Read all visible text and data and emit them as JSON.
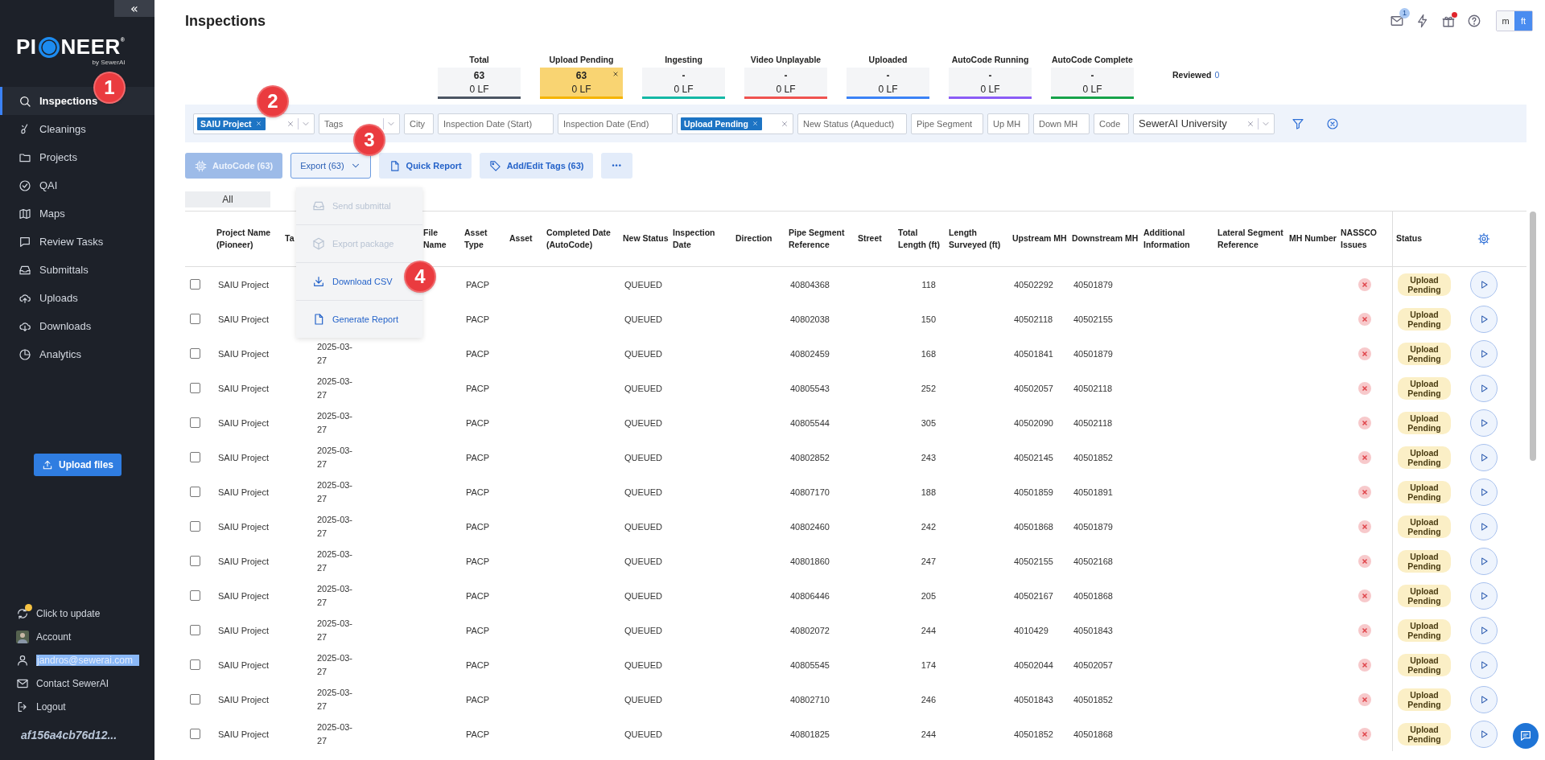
{
  "sidebar": {
    "collapse_button": "«",
    "logo": {
      "left": "PI",
      "right": "NEER",
      "mark": "®",
      "tagline": "by SewerAI"
    },
    "items": [
      {
        "label": "Inspections",
        "selected": true
      },
      {
        "label": "Cleanings",
        "selected": false
      },
      {
        "label": "Projects",
        "selected": false
      },
      {
        "label": "QAI",
        "selected": false
      },
      {
        "label": "Maps",
        "selected": false
      },
      {
        "label": "Review Tasks",
        "selected": false
      },
      {
        "label": "Submittals",
        "selected": false
      },
      {
        "label": "Uploads",
        "selected": false
      },
      {
        "label": "Downloads",
        "selected": false
      },
      {
        "label": "Analytics",
        "selected": false
      }
    ],
    "upload_button": "Upload files",
    "footer": {
      "update": {
        "label": "Click to update",
        "dot": true
      },
      "account": "Account",
      "email": {
        "text": "jandros@sewerai.com",
        "highlighted": true
      },
      "contact": "Contact SewerAI",
      "logout": "Logout",
      "build": "af156a4cb76d12..."
    }
  },
  "page": {
    "title": "Inspections",
    "toolbar": {
      "mail_badge": "1",
      "gift_dot": true,
      "units": [
        {
          "label": "m",
          "selected": false
        },
        {
          "label": "ft",
          "selected": true
        }
      ]
    }
  },
  "status_cards": [
    {
      "label": "Total",
      "count": "63",
      "lf": "0 LF",
      "color": "#4b5563",
      "selected": false
    },
    {
      "label": "Upload Pending",
      "count": "63",
      "lf": "0 LF",
      "color": "#f5b400",
      "selected": true
    },
    {
      "label": "Ingesting",
      "count": "-",
      "lf": "0 LF",
      "color": "#14b8a6",
      "selected": false
    },
    {
      "label": "Video Unplayable",
      "count": "-",
      "lf": "0 LF",
      "color": "#ef5350",
      "selected": false
    },
    {
      "label": "Uploaded",
      "count": "-",
      "lf": "0 LF",
      "color": "#3b82f6",
      "selected": false
    },
    {
      "label": "AutoCode Running",
      "count": "-",
      "lf": "0 LF",
      "color": "#8b5cf6",
      "selected": false
    },
    {
      "label": "AutoCode Complete",
      "count": "-",
      "lf": "0 LF",
      "color": "#16a34a",
      "selected": false
    }
  ],
  "reviewed": {
    "label": "Reviewed",
    "count": "0"
  },
  "filters": [
    {
      "kind": "select",
      "chips": [
        "SAIU Project"
      ],
      "clearable": true,
      "caret": true
    },
    {
      "kind": "select",
      "placeholder": "Tags",
      "clearable": false,
      "caret": true
    },
    {
      "kind": "input",
      "placeholder": "City"
    },
    {
      "kind": "input",
      "placeholder": "Inspection Date (Start)"
    },
    {
      "kind": "input",
      "placeholder": "Inspection Date (End)"
    },
    {
      "kind": "select",
      "chips": [
        "Upload Pending"
      ],
      "clearable": true,
      "caret": false
    },
    {
      "kind": "input",
      "placeholder": "New Status (Aqueduct)"
    },
    {
      "kind": "input",
      "placeholder": "Pipe Segment"
    },
    {
      "kind": "input",
      "placeholder": "Up MH"
    },
    {
      "kind": "input",
      "placeholder": "Down MH"
    },
    {
      "kind": "input",
      "placeholder": "Code"
    },
    {
      "kind": "select",
      "value": "SewerAI University",
      "clearable": true,
      "caret": true
    }
  ],
  "actions": [
    {
      "kind": "autocode",
      "label": "AutoCode (63)",
      "disabled": true
    },
    {
      "kind": "export",
      "label": "Export (63)",
      "disabled": false,
      "expanded": true
    },
    {
      "kind": "report",
      "label": "Quick Report",
      "disabled": false
    },
    {
      "kind": "tags",
      "label": "Add/Edit Tags (63)",
      "disabled": false
    },
    {
      "kind": "more",
      "label": "•••",
      "disabled": false
    }
  ],
  "export_menu": [
    {
      "label": "Send submittal",
      "disabled": true
    },
    {
      "label": "Export package",
      "disabled": true
    },
    {
      "label": "Download CSV",
      "disabled": false
    },
    {
      "label": "Generate Report",
      "disabled": false
    }
  ],
  "tabs": [
    {
      "label": "All",
      "selected": true
    }
  ],
  "table": {
    "columns": [
      "Project Name (Pioneer)",
      "Ta",
      null,
      "File Name",
      "Asset Type",
      "Asset",
      "Completed Date (AutoCode)",
      "New Status",
      "Inspection Date",
      "Direction",
      "Pipe Segment Reference",
      "Street",
      "Total Length (ft)",
      "Length Surveyed (ft)",
      "Upstream MH",
      "Downstream MH",
      "Additional Information",
      "Lateral Segment Reference",
      "MH Number",
      "NASSCO Issues",
      "Status"
    ],
    "rows": [
      {
        "checked": false,
        "status": "Upload Pending",
        "cells": [
          "SAIU Project",
          null,
          null,
          null,
          "PACP",
          null,
          null,
          "QUEUED",
          null,
          null,
          "40804368",
          null,
          "118",
          null,
          "40502292",
          "40501879",
          null,
          null,
          null,
          null
        ]
      },
      {
        "checked": false,
        "status": "Upload Pending",
        "cells": [
          "SAIU Project",
          null,
          null,
          null,
          "PACP",
          null,
          null,
          "QUEUED",
          null,
          null,
          "40802038",
          null,
          "150",
          null,
          "40502118",
          "40502155",
          null,
          null,
          null,
          null
        ]
      },
      {
        "checked": false,
        "status": "Upload Pending",
        "cells": [
          "SAIU Project",
          null,
          "2025-03-27",
          null,
          "PACP",
          null,
          null,
          "QUEUED",
          null,
          null,
          "40802459",
          null,
          "168",
          null,
          "40501841",
          "40501879",
          null,
          null,
          null,
          null
        ]
      },
      {
        "checked": false,
        "status": "Upload Pending",
        "cells": [
          "SAIU Project",
          null,
          "2025-03-27",
          null,
          "PACP",
          null,
          null,
          "QUEUED",
          null,
          null,
          "40805543",
          null,
          "252",
          null,
          "40502057",
          "40502118",
          null,
          null,
          null,
          null
        ]
      },
      {
        "checked": false,
        "status": "Upload Pending",
        "cells": [
          "SAIU Project",
          null,
          "2025-03-27",
          null,
          "PACP",
          null,
          null,
          "QUEUED",
          null,
          null,
          "40805544",
          null,
          "305",
          null,
          "40502090",
          "40502118",
          null,
          null,
          null,
          null
        ]
      },
      {
        "checked": false,
        "status": "Upload Pending",
        "cells": [
          "SAIU Project",
          null,
          "2025-03-27",
          null,
          "PACP",
          null,
          null,
          "QUEUED",
          null,
          null,
          "40802852",
          null,
          "243",
          null,
          "40502145",
          "40501852",
          null,
          null,
          null,
          null
        ]
      },
      {
        "checked": false,
        "status": "Upload Pending",
        "cells": [
          "SAIU Project",
          null,
          "2025-03-27",
          null,
          "PACP",
          null,
          null,
          "QUEUED",
          null,
          null,
          "40807170",
          null,
          "188",
          null,
          "40501859",
          "40501891",
          null,
          null,
          null,
          null
        ]
      },
      {
        "checked": false,
        "status": "Upload Pending",
        "cells": [
          "SAIU Project",
          null,
          "2025-03-27",
          null,
          "PACP",
          null,
          null,
          "QUEUED",
          null,
          null,
          "40802460",
          null,
          "242",
          null,
          "40501868",
          "40501879",
          null,
          null,
          null,
          null
        ]
      },
      {
        "checked": false,
        "status": "Upload Pending",
        "cells": [
          "SAIU Project",
          null,
          "2025-03-27",
          null,
          "PACP",
          null,
          null,
          "QUEUED",
          null,
          null,
          "40801860",
          null,
          "247",
          null,
          "40502155",
          "40502168",
          null,
          null,
          null,
          null
        ]
      },
      {
        "checked": false,
        "status": "Upload Pending",
        "cells": [
          "SAIU Project",
          null,
          "2025-03-27",
          null,
          "PACP",
          null,
          null,
          "QUEUED",
          null,
          null,
          "40806446",
          null,
          "205",
          null,
          "40502167",
          "40501868",
          null,
          null,
          null,
          null
        ]
      },
      {
        "checked": false,
        "status": "Upload Pending",
        "cells": [
          "SAIU Project",
          null,
          "2025-03-27",
          null,
          "PACP",
          null,
          null,
          "QUEUED",
          null,
          null,
          "40802072",
          null,
          "244",
          null,
          "4010429",
          "40501843",
          null,
          null,
          null,
          null
        ]
      },
      {
        "checked": false,
        "status": "Upload Pending",
        "cells": [
          "SAIU Project",
          null,
          "2025-03-27",
          null,
          "PACP",
          null,
          null,
          "QUEUED",
          null,
          null,
          "40805545",
          null,
          "174",
          null,
          "40502044",
          "40502057",
          null,
          null,
          null,
          null
        ]
      },
      {
        "checked": false,
        "status": "Upload Pending",
        "cells": [
          "SAIU Project",
          null,
          "2025-03-27",
          null,
          "PACP",
          null,
          null,
          "QUEUED",
          null,
          null,
          "40802710",
          null,
          "246",
          null,
          "40501843",
          "40501852",
          null,
          null,
          null,
          null
        ]
      },
      {
        "checked": false,
        "status": "Upload Pending",
        "cells": [
          "SAIU Project",
          null,
          "2025-03-27",
          null,
          "PACP",
          null,
          null,
          "QUEUED",
          null,
          null,
          "40801825",
          null,
          "244",
          null,
          "40501852",
          "40501868",
          null,
          null,
          null,
          null
        ]
      }
    ]
  },
  "annotations": [
    {
      "label": "1"
    },
    {
      "label": "2"
    },
    {
      "label": "3"
    },
    {
      "label": "4"
    }
  ]
}
